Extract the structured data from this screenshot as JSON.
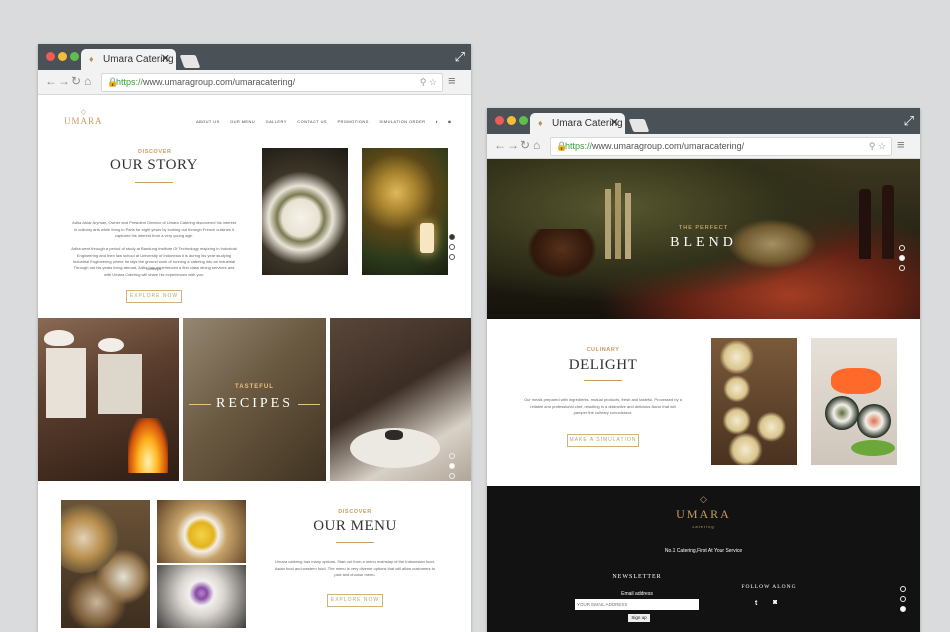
{
  "colors": {
    "chrome": "#4a5257",
    "gold": "#c79d62",
    "page_bg": "#d9dbdc"
  },
  "left_window": {
    "tab_title": "Umara Catering",
    "url_prefix": "https://",
    "url_rest": "www.umaragroup.com/umaracatering/",
    "logo": "UMARA",
    "nav": [
      "ABOUT US",
      "OUR MENU",
      "GALLERY",
      "CONTACT US",
      "PROMOTIONS",
      "SIMULATION ORDER"
    ],
    "story": {
      "eyebrow": "DISCOVER",
      "title": "OUR STORY",
      "p1": "Adha Abiar Aryman, Owner and President Director of Umara Catering discovered his interest in culinary arts while living in Paris for eight years by looking out through French cuisines it captured his interest from a very young age.",
      "p2": "Adha went through a period of study at Bandung Institute Of Technology majoring in Industrial Engineering and then law school at University of Indonesia it is during his year studying Industrial Engineering where he lays the ground work of running a catering into an industrial concept.",
      "p3": "Through out his years living abroad, Adha has experienced a first class dining services and with Umara Catering will share his experiences with you.",
      "button": "EXPLORE NOW"
    },
    "recipes": {
      "eyebrow": "TASTEFUL",
      "title": "RECIPES"
    },
    "menu": {
      "eyebrow": "DISCOVER",
      "title": "OUR MENU",
      "p1": "Umara catering has many options. Start out from a menu mainstay of the Indonesian food, Asian food and western food. The menu is very diverse options that will allow customers to pick and choose menu.",
      "button": "EXPLORE NOW"
    }
  },
  "right_window": {
    "tab_title": "Umara Catering",
    "url_prefix": "https://",
    "url_rest": "www.umaragroup.com/umaracatering/",
    "hero": {
      "eyebrow": "THE PERFECT",
      "title": "BLEND"
    },
    "culinary": {
      "eyebrow": "CULINARY",
      "title": "DELIGHT",
      "p1": "Our meals prepared with ingredients, mutual products, fresh and tasteful. Processed by a reliable and professional chef, resulting in a distinctive and delicious flavor that will pamper the culinary connoisseur.",
      "button": "MAKE A SIMULATION"
    },
    "footer": {
      "logo": "UMARA",
      "logo_sub": "catering",
      "tagline": "No.1 Catering,First At Your Service",
      "newsletter_title": "NEWSLETTER",
      "email_label": "Email address",
      "email_placeholder": "YOUR EMAIL ADDRESS",
      "signup": "Sign up",
      "follow": "FOLLOW ALONG"
    }
  }
}
